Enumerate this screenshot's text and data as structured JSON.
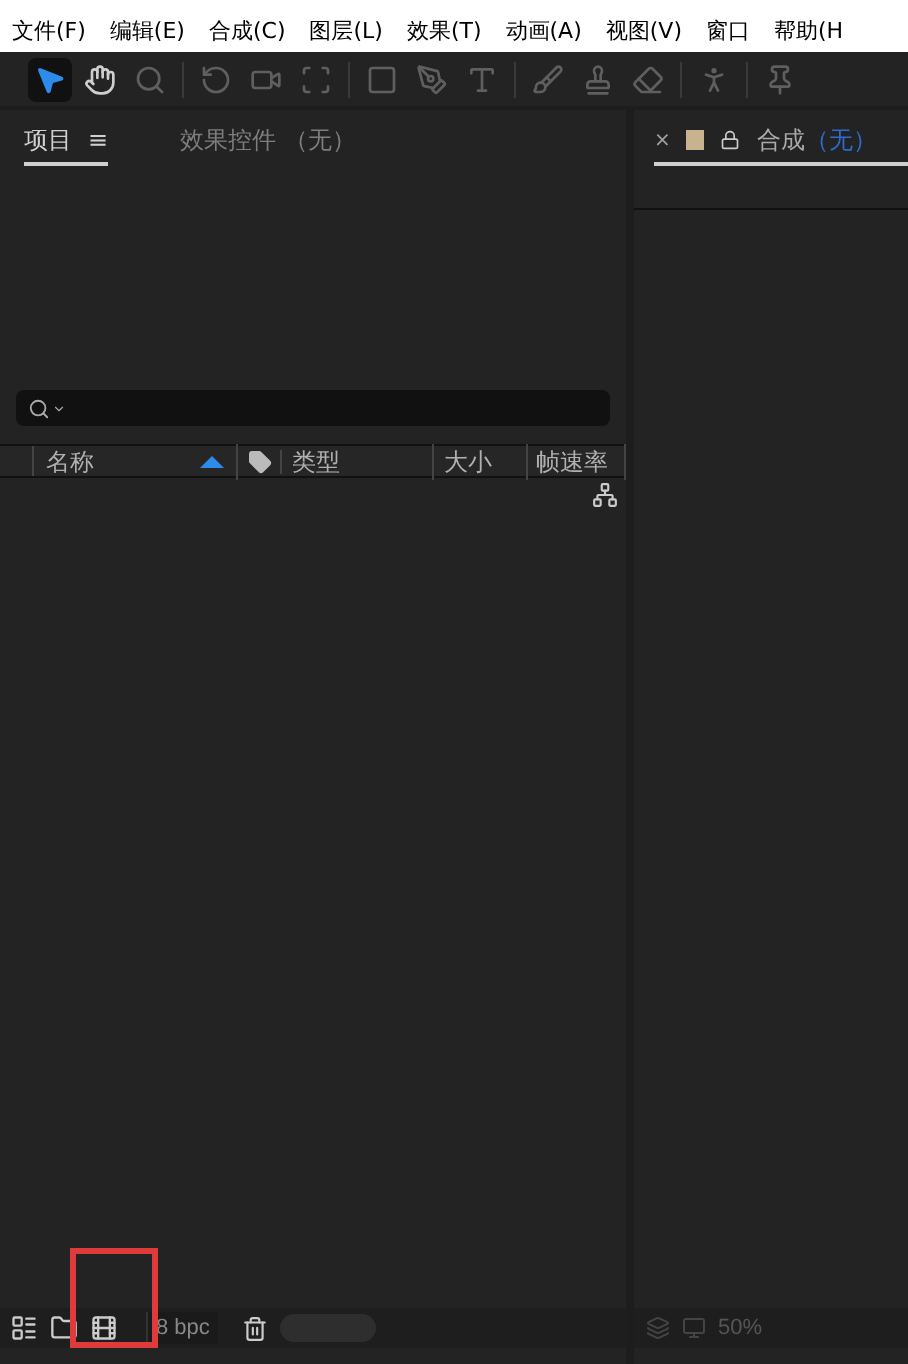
{
  "menu": [
    "文件(F)",
    "编辑(E)",
    "合成(C)",
    "图层(L)",
    "效果(T)",
    "动画(A)",
    "视图(V)",
    "窗口",
    "帮助(H"
  ],
  "tools": [
    {
      "selected": true,
      "disabled": false
    },
    {
      "selected": false,
      "disabled": false
    },
    {
      "selected": false,
      "disabled": true
    },
    {
      "selected": false,
      "disabled": true
    },
    {
      "selected": false,
      "disabled": true
    },
    {
      "selected": false,
      "disabled": true
    },
    {
      "selected": false,
      "disabled": true
    },
    {
      "selected": false,
      "disabled": true
    },
    {
      "selected": false,
      "disabled": true
    },
    {
      "selected": false,
      "disabled": true
    },
    {
      "selected": false,
      "disabled": true
    },
    {
      "selected": false,
      "disabled": true
    },
    {
      "selected": false,
      "disabled": true
    },
    {
      "selected": false,
      "disabled": true
    }
  ],
  "project_panel": {
    "tabs": [
      {
        "label": "项目",
        "selected": true,
        "menu": "≡"
      },
      {
        "label": "效果控件 （无）",
        "selected": false
      }
    ],
    "columns": [
      "名称",
      "类型",
      "大小",
      "帧速率"
    ],
    "footer": {
      "icons": [
        {
          "highlighted": false
        },
        {
          "highlighted": false
        },
        {
          "highlighted": true
        }
      ],
      "bit_depth": "8 bpc"
    }
  },
  "comp_panel": {
    "close": "×",
    "title": "合成",
    "subtitle": "（无）",
    "zoom": "50%"
  }
}
